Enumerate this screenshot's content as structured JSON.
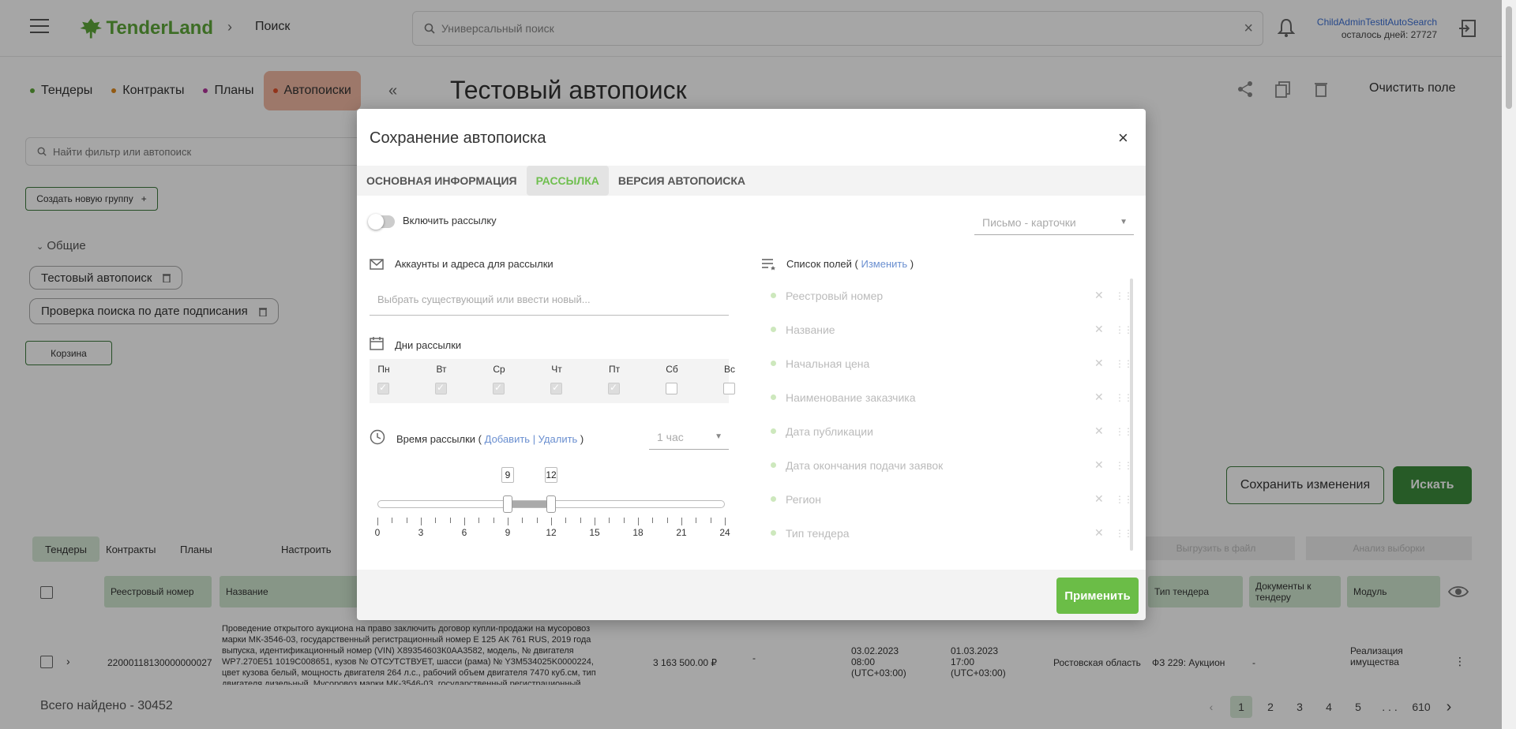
{
  "header": {
    "brand": "TenderLand",
    "breadcrumb": "Поиск",
    "search_placeholder": "Универсальный поиск",
    "user_name": "ChildAdminTestitAutoSearch",
    "days_left": "осталось дней: 27727"
  },
  "left": {
    "tabs": [
      {
        "label": "Тендеры",
        "color": "#5fa83a"
      },
      {
        "label": "Контракты",
        "color": "#e08a1e"
      },
      {
        "label": "Планы",
        "color": "#b3359b"
      },
      {
        "label": "Автопоиски",
        "color": "#e0502a"
      }
    ],
    "filter_placeholder": "Найти фильтр или автопоиск",
    "create_group": "Создать новую группу",
    "group_name": "Общие",
    "items": [
      "Тестовый автопоиск",
      "Проверка поиска по дате подписания"
    ],
    "trash": "Корзина"
  },
  "main": {
    "title": "Тестовый автопоиск",
    "clear": "Очистить поле",
    "save": "Сохранить изменения",
    "search": "Искать"
  },
  "results": {
    "tabs": [
      "Тендеры",
      "Контракты",
      "Планы"
    ],
    "configure": "Настроить",
    "export": "Выгрузить в файл",
    "analysis": "Анализ выборки",
    "columns": [
      "Реестровый номер",
      "Название",
      "Тип тендера",
      "Документы к тендеру",
      "Модуль"
    ],
    "row": {
      "number": "22000118130000000027",
      "name_lines": [
        "Проведение открытого аукциона на право заключить договор купли-продажи на мусоровоз",
        "марки МК-3546-03, государственный регистрационный номер Е 125 АК 761 RUS, 2019 года",
        "выпуска, идентификационный номер (VIN) Х89354603К0АА3582, модель, № двигателя",
        "WP7.270E51 1019С008651, кузов № ОТСУТСТВУЕТ, шасси (рама) № Y3M534025K0000224,",
        "цвет кузова белый, мощность двигателя 264 л.с., рабочий объем двигателя 7470 куб.см, тип",
        "двигателя дизельный. Мусоровоз марки МК-3546-03, государственный регистрационный"
      ],
      "price": "3 163 500.00 ₽",
      "dash": "-",
      "pub_date": "03.02.2023",
      "pub_time": "08:00",
      "pub_tz": "(UTC+03:00)",
      "end_date": "01.03.2023",
      "end_time": "17:00",
      "end_tz": "(UTC+03:00)",
      "region": "Ростовская область",
      "type": "ФЗ 229: Аукцион",
      "docs": "-",
      "module": "Реализация имущества"
    },
    "total": "Всего найдено - 30452",
    "pages": [
      "1",
      "2",
      "3",
      "4",
      "5",
      ". . .",
      "610"
    ]
  },
  "modal": {
    "title": "Сохранение автопоиска",
    "tabs": [
      "ОСНОВНАЯ ИНФОРМАЦИЯ",
      "РАССЫЛКА",
      "ВЕРСИЯ АВТОПОИСКА"
    ],
    "enable_label": "Включить рассылку",
    "format": "Письмо - карточки",
    "accounts_label": "Аккаунты и адреса для рассылки",
    "accounts_placeholder": "Выбрать существующий или ввести новый...",
    "days_label": "Дни рассылки",
    "days": [
      {
        "label": "Пн",
        "checked": true
      },
      {
        "label": "Вт",
        "checked": true
      },
      {
        "label": "Ср",
        "checked": true
      },
      {
        "label": "Чт",
        "checked": true
      },
      {
        "label": "Пт",
        "checked": true
      },
      {
        "label": "Сб",
        "checked": false
      },
      {
        "label": "Вс",
        "checked": false
      }
    ],
    "time_label": "Время рассылки",
    "time_links": "Добавить | Удалить",
    "interval": "1 час",
    "slider": {
      "min": 0,
      "max": 24,
      "from": 9,
      "to": 12,
      "from_label": "9",
      "to_label": "12"
    },
    "ticks": [
      "0",
      "3",
      "6",
      "9",
      "12",
      "15",
      "18",
      "21",
      "24"
    ],
    "fields_label": "Список полей",
    "fields_change": "Изменить",
    "fields": [
      "Реестровый номер",
      "Название",
      "Начальная цена",
      "Наименование заказчика",
      "Дата публикации",
      "Дата окончания подачи заявок",
      "Регион",
      "Тип тендера"
    ],
    "apply": "Применить"
  }
}
